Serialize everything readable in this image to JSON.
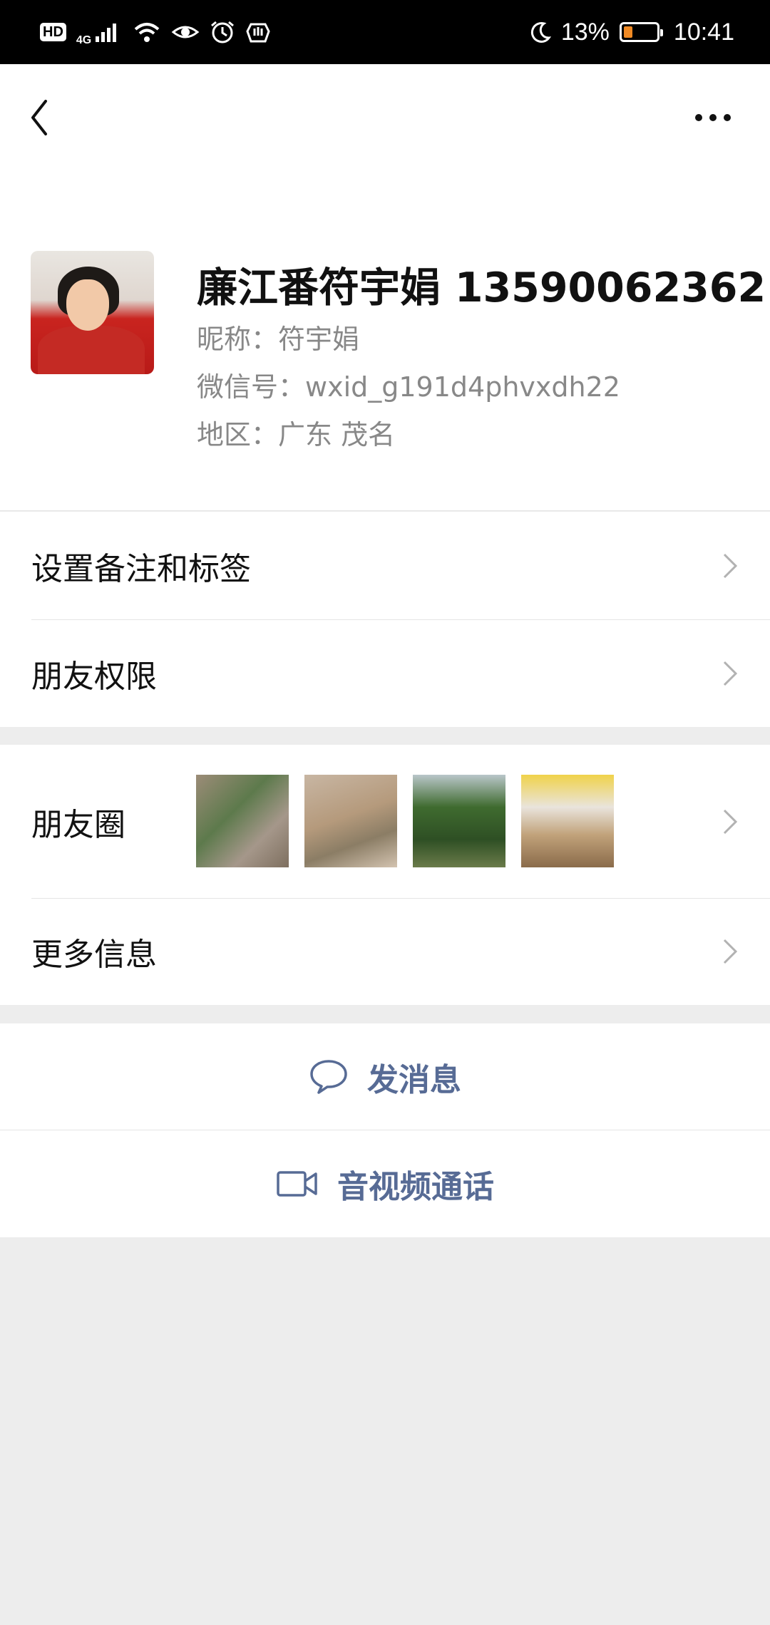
{
  "status_bar": {
    "left_icons": [
      "hd-icon",
      "signal-4g-icon",
      "wifi-icon",
      "eye-icon",
      "alarm-icon",
      "hand-icon"
    ],
    "hd_label": "HD",
    "network_label": "4G",
    "battery_percent": "13%",
    "battery_level": 0.13,
    "time": "10:41"
  },
  "profile": {
    "display_name": "廉江番符宇娟 13590062362",
    "nickname": "昵称：符宇娟",
    "wechat_id": "微信号：wxid_g191d4phvxdh22",
    "region": "地区：广东  茂名",
    "gender_icon_color": "#e8663c"
  },
  "menu": {
    "remark_tags": "设置备注和标签",
    "friend_permissions": "朋友权限",
    "moments": "朋友圈",
    "more_info": "更多信息"
  },
  "actions": {
    "send_message": "发消息",
    "av_call": "音视频通话"
  },
  "colors": {
    "link_blue": "#576b95",
    "page_bg": "#ededed"
  }
}
